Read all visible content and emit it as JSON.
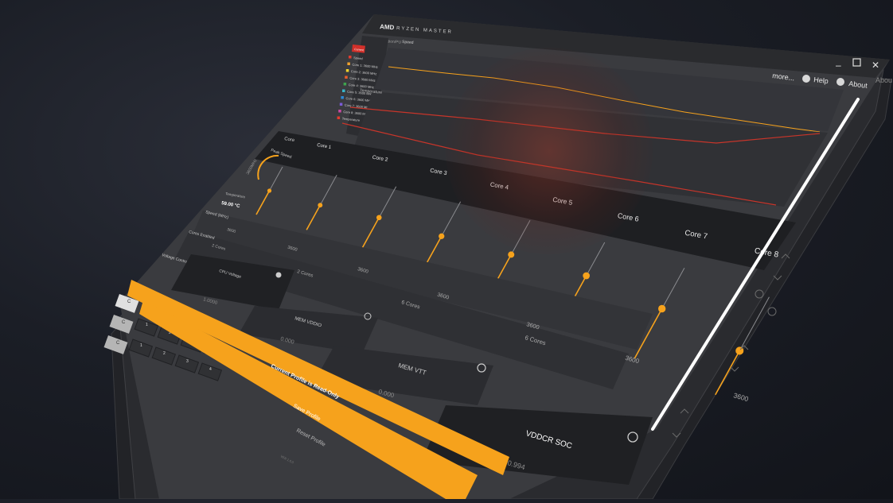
{
  "app": {
    "logo": "AMD",
    "title": "RYZEN MASTER",
    "subtitle": "Configuration/PU",
    "speed_label": "Speed",
    "more_label": "more...",
    "help_label": "Help",
    "about_label": "About",
    "about_peek": "Abou"
  },
  "sidebar": {
    "current_label": "Current",
    "items": [
      "Speed",
      "Core 1: 3600 MHz",
      "Core 2: 3600 MHz",
      "Core 3: 3600 MHz",
      "Core 4: 3600 MHz",
      "Core 5: 3600 MHz",
      "Core 6: 3600 MHz",
      "Core 7: 3600 MHz",
      "Core 8: 3600 MHz",
      "Temperature"
    ],
    "item_colors": [
      "#e23b2f",
      "#f0a22c",
      "#f0d02c",
      "#e95c2a",
      "#3fa34d",
      "#38b6c9",
      "#2c8ad6",
      "#7a5bd6",
      "#c94aa5",
      "#e23b2f"
    ]
  },
  "graph": {
    "temperature_label": "Temperature"
  },
  "cores": {
    "core_label": "Core",
    "headers": [
      "Core 1",
      "Core 2",
      "Core 3",
      "Core 4",
      "Core 5",
      "Core 6",
      "Core 7",
      "Core 8"
    ],
    "levels": [
      0.5,
      0.45,
      0.5,
      0.5,
      0.55,
      0.6,
      0.55,
      0.45
    ]
  },
  "gauge": {
    "label": "Peak Speed",
    "value": "3600MHz",
    "temperature_label": "Temperature",
    "temperature_value": "59.00 °C"
  },
  "rows": {
    "speed_label": "Speed (MHz)",
    "cores_enabled_label": "Cores Enabled",
    "voltage_label": "Voltage Control(V)",
    "cpu_voltage_label": "CPU Voltage",
    "cpu_voltage_value": "1.0000",
    "mem_vddio_label": "MEM VDDIO",
    "mem_vddio_value": "0.000",
    "mem_vtt_label": "MEM VTT",
    "mem_vtt_value": "0.000",
    "vddcr_soc_label": "VDDCR SOC",
    "vddcr_soc_value": "0.994",
    "speed_values": [
      "3600",
      "3600",
      "3600",
      "3600",
      "3600",
      "3600",
      "3600"
    ],
    "cores_values": [
      "2 Cores",
      "2 Cores",
      "6 Cores",
      "6 Cores"
    ]
  },
  "profiles": {
    "tab_c": "C",
    "tabs": [
      "1",
      "2",
      "3",
      "4"
    ],
    "banner": "Current Profile is Read-Only",
    "save_label": "Save Profile",
    "reset_label": "Reset Profile",
    "version": "VER 1.0.0"
  },
  "colors": {
    "accent": "#f6a21c",
    "red_line": "#c8352a",
    "window_bg": "#3b3c40",
    "panel_dark": "#1e1f22"
  }
}
